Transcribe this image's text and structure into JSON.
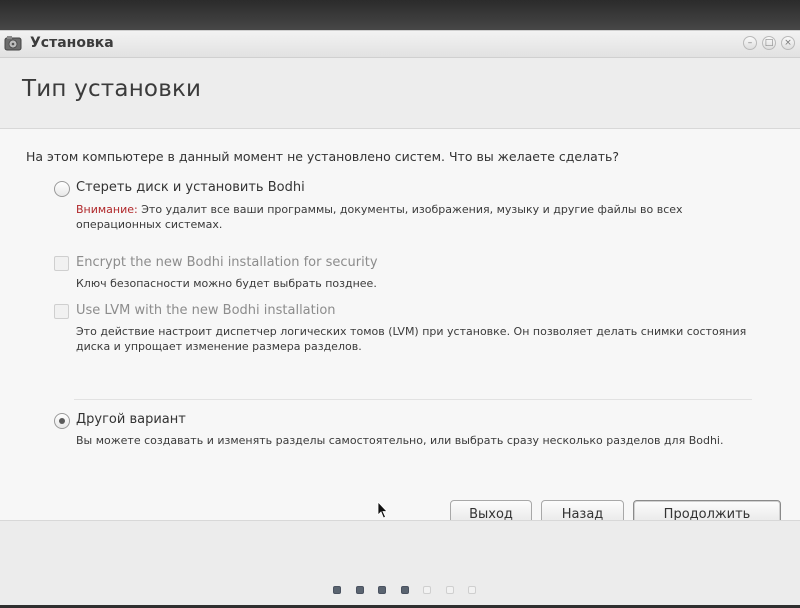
{
  "window": {
    "title": "Установка",
    "app_icon": "disk-install-icon",
    "controls": [
      "minimize-icon",
      "maximize-icon",
      "close-icon"
    ]
  },
  "header": {
    "title": "Тип установки"
  },
  "content": {
    "question": "На этом компьютере в данный момент не установлено систем. Что вы желаете сделать?",
    "options": [
      {
        "kind": "radio",
        "label": "Стереть диск и установить Bodhi",
        "checked": false,
        "enabled": true,
        "warning_label": "Внимание:",
        "description": "Это удалит все ваши программы, документы, изображения, музыку и другие файлы во всех операционных системах."
      },
      {
        "kind": "checkbox",
        "label": "Encrypt the new Bodhi installation for security",
        "checked": false,
        "enabled": false,
        "description": "Ключ безопасности можно будет выбрать позднее."
      },
      {
        "kind": "checkbox",
        "label": "Use LVM with the new Bodhi installation",
        "checked": false,
        "enabled": false,
        "description": "Это действие настроит диспетчер логических томов (LVM) при установке. Он позволяет делать снимки состояния диска и упрощает изменение размера разделов."
      },
      {
        "kind": "radio",
        "label": "Другой вариант",
        "checked": true,
        "enabled": true,
        "description": "Вы можете создавать и изменять разделы самостоятельно, или выбрать сразу несколько разделов для Bodhi."
      }
    ]
  },
  "buttons": {
    "quit": "Выход",
    "back": "Назад",
    "continue": "Продолжить"
  },
  "progress": {
    "total_steps": 7,
    "completed_steps": 4
  },
  "colors": {
    "warning": "#b0272a",
    "dot_filled": "#5a6470",
    "dot_empty": "#f2f2f2"
  }
}
